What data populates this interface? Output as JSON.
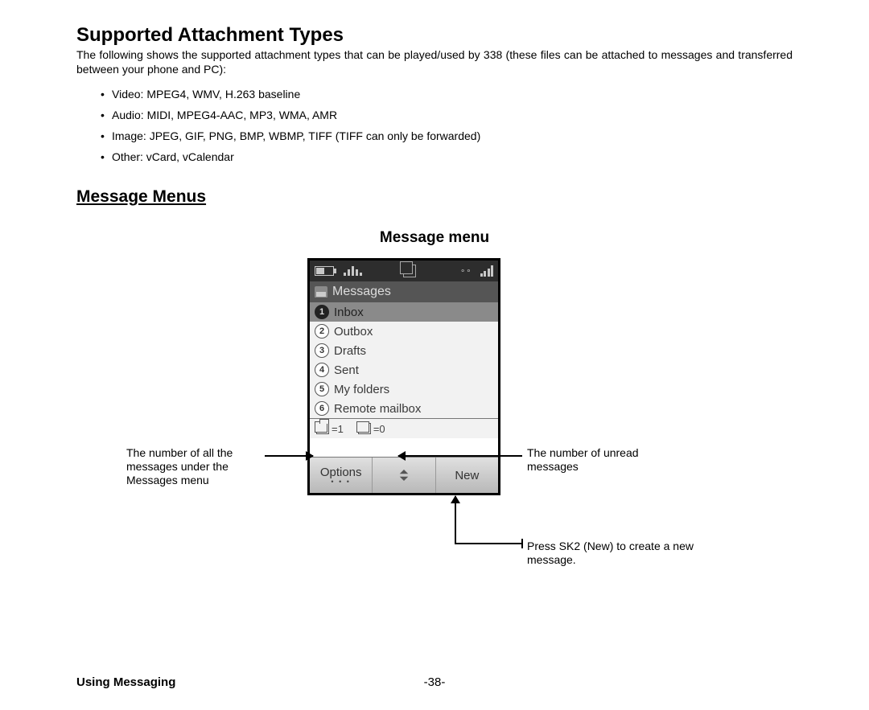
{
  "section1": {
    "title": "Supported Attachment Types",
    "intro": "The following shows the supported attachment types that can be played/used by 338 (these files can be attached to messages and transferred between your phone and PC):",
    "items": [
      "Video: MPEG4, WMV, H.263 baseline",
      "Audio: MIDI, MPEG4-AAC, MP3, WMA, AMR",
      "Image: JPEG, GIF, PNG, BMP, WBMP, TIFF (TIFF can only be forwarded)",
      "Other: vCard, vCalendar"
    ]
  },
  "section2": {
    "title": "Message Menus",
    "figure_caption": "Message menu"
  },
  "phone": {
    "screen_title": "Messages",
    "menu": [
      {
        "n": "1",
        "label": "Inbox",
        "selected": true
      },
      {
        "n": "2",
        "label": "Outbox",
        "selected": false
      },
      {
        "n": "3",
        "label": "Drafts",
        "selected": false
      },
      {
        "n": "4",
        "label": "Sent",
        "selected": false
      },
      {
        "n": "5",
        "label": "My folders",
        "selected": false
      },
      {
        "n": "6",
        "label": "Remote mailbox",
        "selected": false
      }
    ],
    "count_total_label": "=1",
    "count_unread_label": "=0",
    "softkey_left": "Options",
    "softkey_right": "New"
  },
  "annotations": {
    "left": "The number of all the messages under the Messages menu",
    "right_top": "The number of unread messages",
    "right_bottom": "Press SK2 (New) to create a new message."
  },
  "footer": {
    "left": "Using Messaging",
    "center": "-38-"
  }
}
